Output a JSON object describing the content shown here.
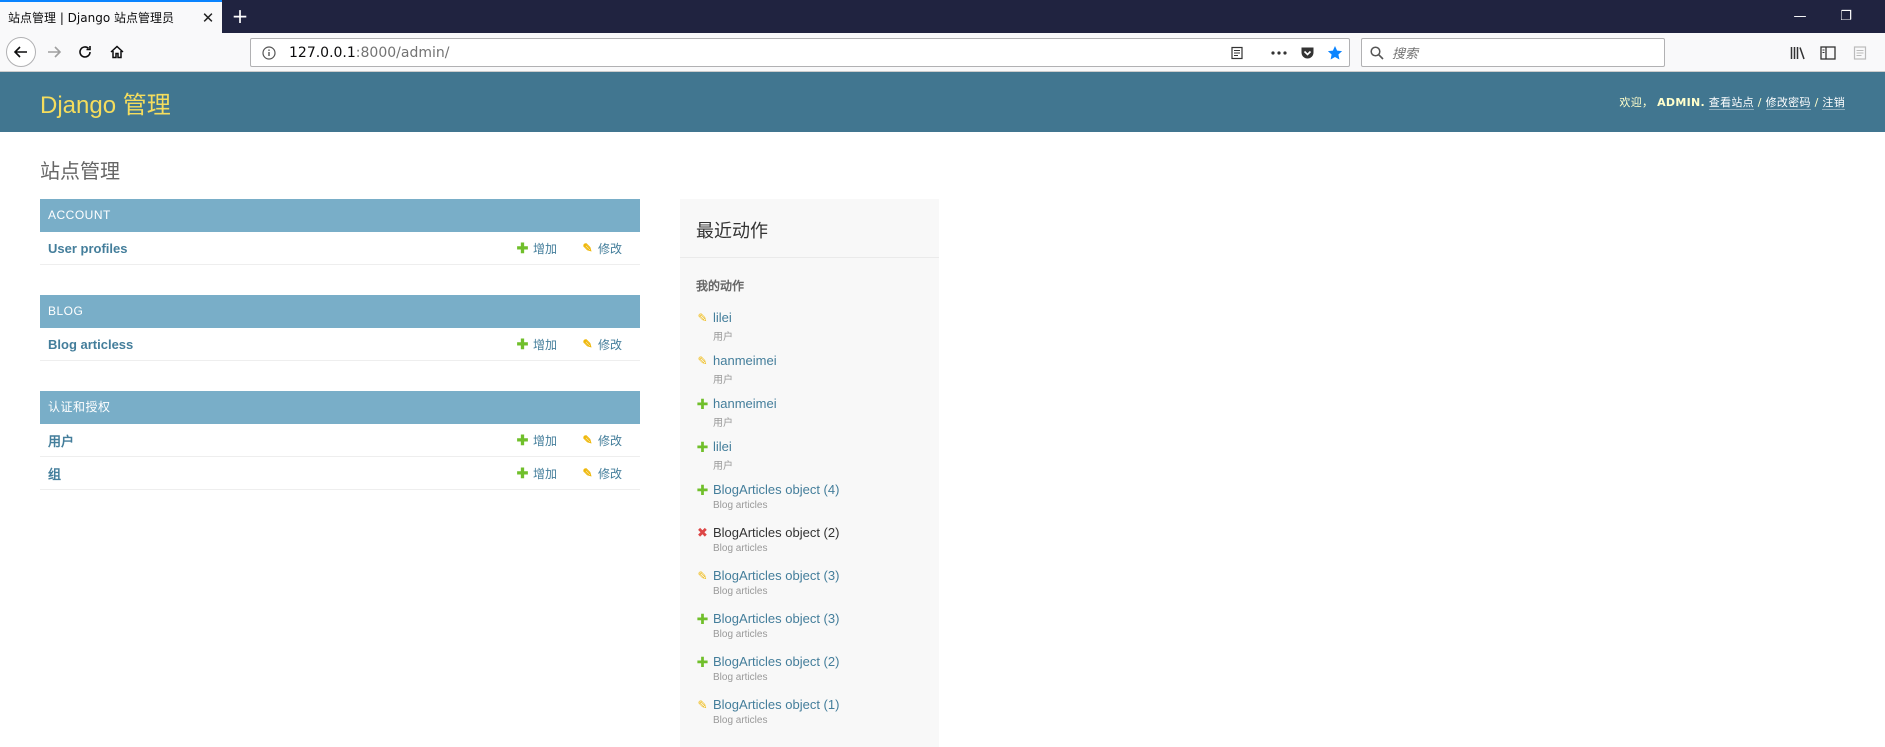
{
  "browser": {
    "tab_title": "站点管理 | Django 站点管理员",
    "url_host": "127.0.0.1",
    "url_rest": ":8000/admin/",
    "search_placeholder": "搜索"
  },
  "header": {
    "branding": "Django 管理",
    "welcome": "欢迎，",
    "username": "ADMIN.",
    "view_site": "查看站点",
    "change_password": "修改密码",
    "logout": "注销",
    "separator": " / "
  },
  "page_title": "站点管理",
  "labels": {
    "add": "增加",
    "change": "修改"
  },
  "apps": [
    {
      "caption": "ACCOUNT",
      "models": [
        {
          "name": "User profiles"
        }
      ]
    },
    {
      "caption": "BLOG",
      "models": [
        {
          "name": "Blog articless"
        }
      ]
    },
    {
      "caption": "认证和授权",
      "models": [
        {
          "name": "用户"
        },
        {
          "name": "组"
        }
      ]
    }
  ],
  "recent_actions": {
    "title": "最近动作",
    "subtitle": "我的动作",
    "items": [
      {
        "action": "change",
        "object": "lilei",
        "type": "用户"
      },
      {
        "action": "change",
        "object": "hanmeimei",
        "type": "用户"
      },
      {
        "action": "add",
        "object": "hanmeimei",
        "type": "用户"
      },
      {
        "action": "add",
        "object": "lilei",
        "type": "用户"
      },
      {
        "action": "add",
        "object": "BlogArticles object (4)",
        "type": "Blog articles"
      },
      {
        "action": "delete",
        "object": "BlogArticles object (2)",
        "type": "Blog articles"
      },
      {
        "action": "change",
        "object": "BlogArticles object (3)",
        "type": "Blog articles"
      },
      {
        "action": "add",
        "object": "BlogArticles object (3)",
        "type": "Blog articles"
      },
      {
        "action": "add",
        "object": "BlogArticles object (2)",
        "type": "Blog articles"
      },
      {
        "action": "change",
        "object": "BlogArticles object (1)",
        "type": "Blog articles"
      }
    ]
  },
  "colors": {
    "header_bg": "#417690",
    "branding": "#f5dd5d",
    "module_caption": "#79aec8",
    "link": "#447e9b",
    "add_icon": "#70bf2b",
    "change_icon": "#efb80b",
    "delete_icon": "#dd4646"
  }
}
